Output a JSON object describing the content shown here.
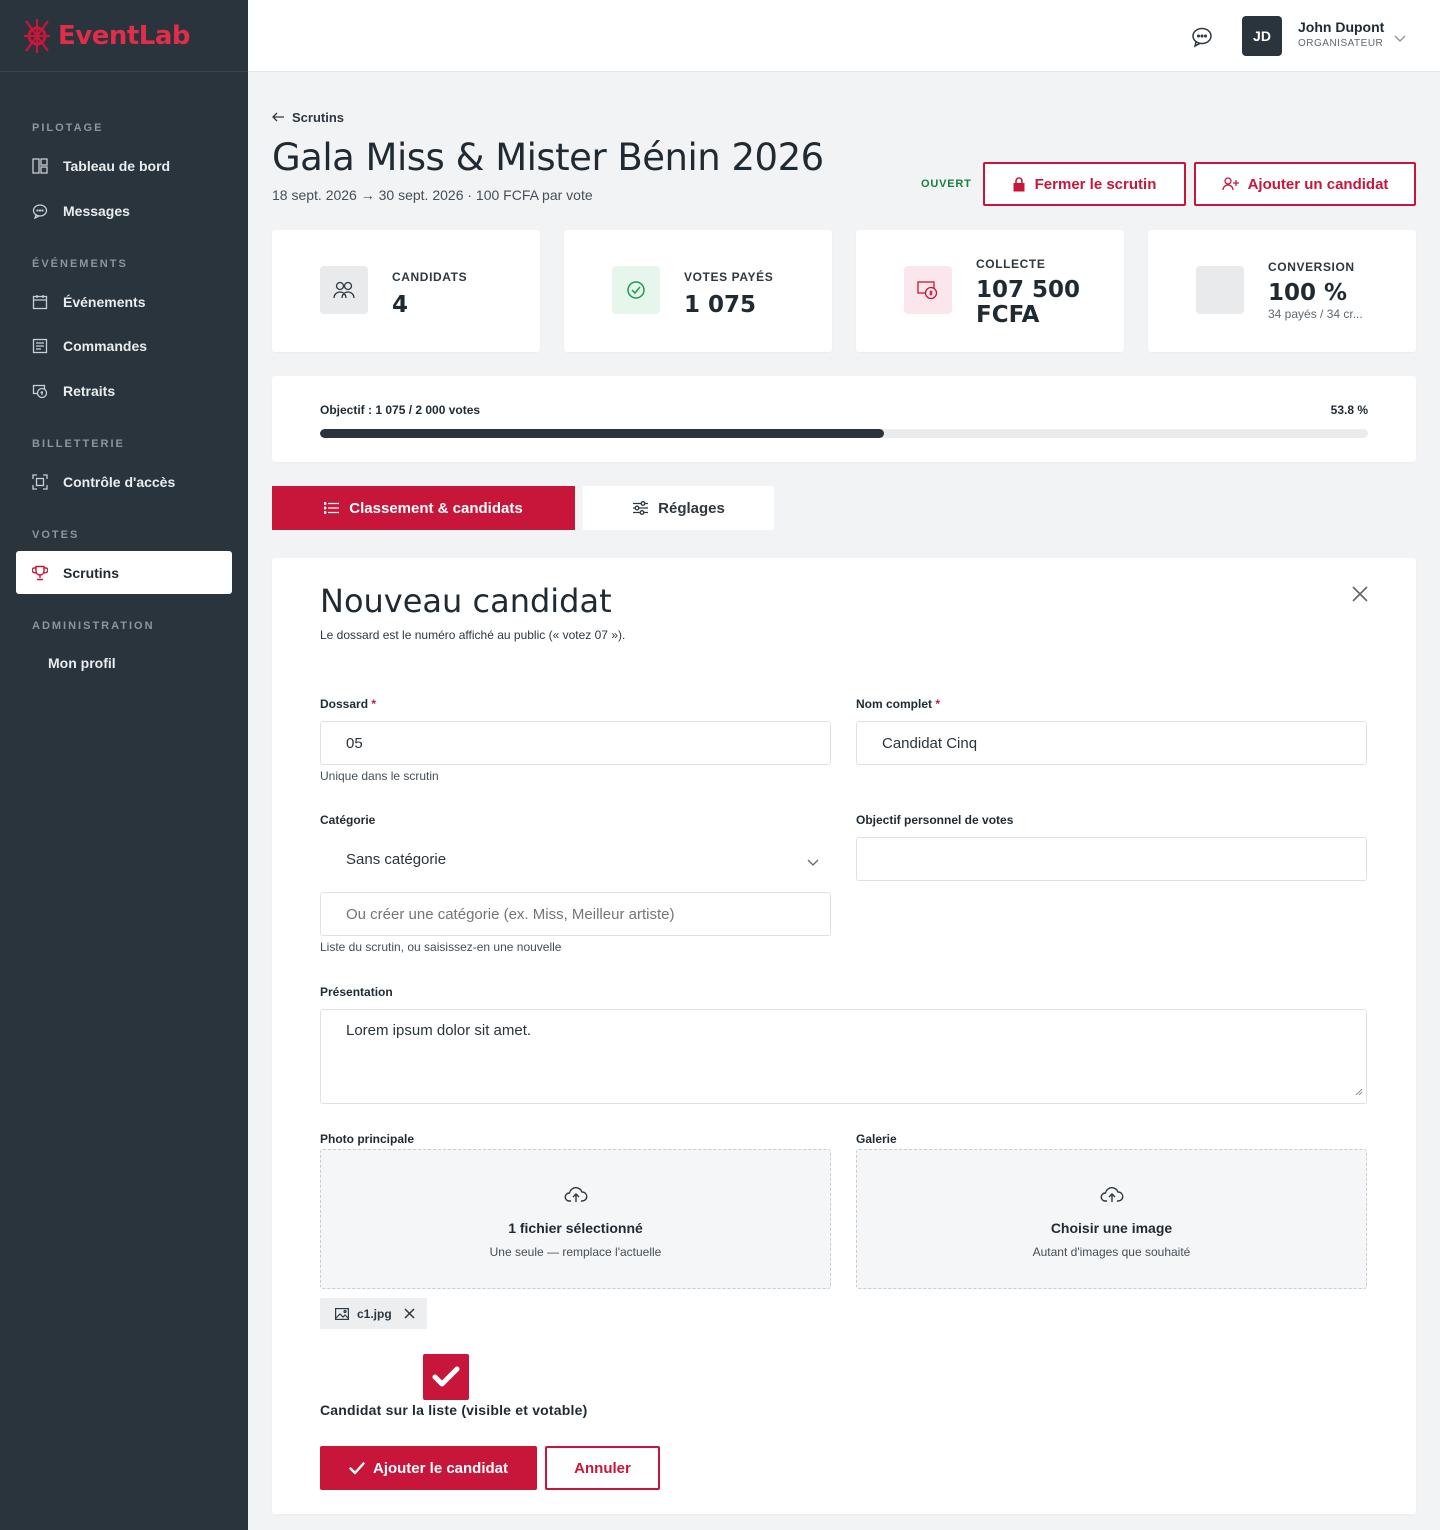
{
  "brand": {
    "name_part1": "Event",
    "name_part2": "Lab",
    "accent": "#c8163b",
    "sidebar_bg": "#29343c"
  },
  "sidebar": {
    "sections": [
      {
        "title": "PILOTAGE"
      },
      {
        "title": "ÉVÉNEMENTS"
      },
      {
        "title": "BILLETTERIE"
      },
      {
        "title": "VOTES"
      },
      {
        "title": "ADMINISTRATION"
      }
    ],
    "items": [
      {
        "label": "Tableau de bord",
        "icon": "dashboard-icon"
      },
      {
        "label": "Messages",
        "icon": "chat-icon"
      },
      {
        "label": "Événements",
        "icon": "calendar-icon"
      },
      {
        "label": "Commandes",
        "icon": "orders-icon"
      },
      {
        "label": "Retraits",
        "icon": "withdrawal-icon"
      },
      {
        "label": "Contrôle d'accès",
        "icon": "scan-icon"
      },
      {
        "label": "Scrutins",
        "icon": "trophy-icon",
        "active": true
      },
      {
        "label": "Mon profil",
        "icon": ""
      }
    ]
  },
  "topbar": {
    "user_initials": "JD",
    "user_name": "John Dupont",
    "user_role": "ORGANISATEUR"
  },
  "header": {
    "breadcrumb": "Scrutins",
    "title": "Gala Miss & Mister Bénin 2026",
    "subtitle": "18 sept. 2026 → 30 sept. 2026 · 100 FCFA par vote",
    "status": "OUVERT",
    "close_label": "Fermer le scrutin",
    "add_label": "Ajouter un candidat"
  },
  "stats": [
    {
      "label": "CANDIDATS",
      "value": "4"
    },
    {
      "label": "VOTES PAYÉS",
      "value": "1 075"
    },
    {
      "label": "COLLECTE",
      "value_line1": "107 500",
      "value_line2": "FCFA"
    },
    {
      "label": "CONVERSION",
      "value": "100 %",
      "sub": "34 payés / 34 cr..."
    }
  ],
  "progress": {
    "label": "Objectif : 1 075 / 2 000 votes",
    "percent_label": "53.8 %",
    "fraction": 0.538
  },
  "tabs": [
    {
      "label": "Classement & candidats",
      "active": true
    },
    {
      "label": "Réglages",
      "active": false
    }
  ],
  "form": {
    "title": "Nouveau candidat",
    "subtitle": "Le dossard est le numéro affiché au public (« votez 07 »).",
    "dossard_label": "Dossard",
    "dossard_value": "05",
    "dossard_hint": "Unique dans le scrutin",
    "name_label": "Nom complet",
    "name_value": "Candidat Cinq",
    "category_label": "Catégorie",
    "category_value": "Sans catégorie",
    "category_new_placeholder": "Ou créer une catégorie (ex. Miss, Meilleur artiste)",
    "category_hint": "Liste du scrutin, ou saisissez-en une nouvelle",
    "goal_label": "Objectif personnel de votes",
    "goal_value": "",
    "presentation_label": "Présentation",
    "presentation_value": "Lorem ipsum dolor sit amet.",
    "photo_label": "Photo principale",
    "photo_title": "1 fichier sélectionné",
    "photo_sub": "Une seule — remplace l'actuelle",
    "gallery_label": "Galerie",
    "gallery_title": "Choisir une image",
    "gallery_sub": "Autant d'images que souhaité",
    "file_chip": "c1.jpg",
    "listed_label": "Candidat sur la liste (visible et votable)",
    "listed_checked": true,
    "submit_label": "Ajouter le candidat",
    "cancel_label": "Annuler"
  }
}
